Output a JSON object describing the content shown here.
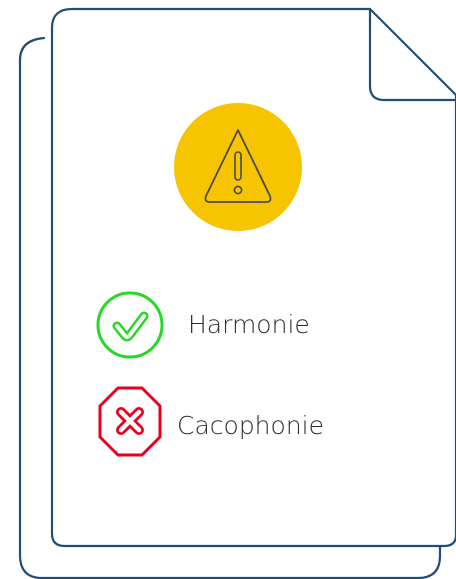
{
  "icons": {
    "warning": "warning-triangle-icon",
    "ok": "check-circle-icon",
    "bad": "x-octagon-icon"
  },
  "colors": {
    "outline": "#1f4e79",
    "warning_fill": "#f6c400",
    "ok": "#26d926",
    "bad": "#e8001c"
  },
  "items": [
    {
      "label": "Harmonie",
      "status": "ok"
    },
    {
      "label": "Cacophonie",
      "status": "bad"
    }
  ]
}
